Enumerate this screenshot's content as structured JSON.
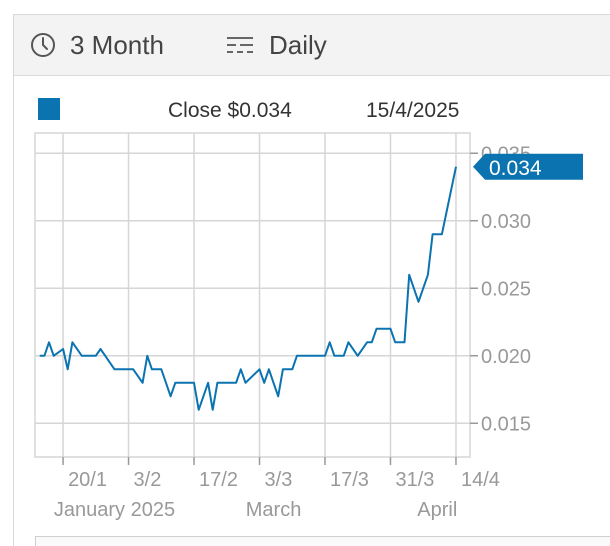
{
  "toolbar": {
    "range_icon": "clock-icon",
    "range_label": "3 Month",
    "interval_icon": "interval-lines-icon",
    "interval_label": "Daily"
  },
  "legend": {
    "swatch_color": "#0a73b0",
    "close_label": "Close $0.034",
    "date_label": "15/4/2025"
  },
  "colors": {
    "line": "#0a73b0",
    "badge": "#0a73b0",
    "grid": "#d6d6d6",
    "tick": "#999999"
  },
  "chart_data": {
    "type": "line",
    "y_ticks": [
      "0.015",
      "0.020",
      "0.025",
      "0.030",
      "0.035"
    ],
    "y_tick_values": [
      0.015,
      0.02,
      0.025,
      0.03,
      0.035
    ],
    "ylim": [
      0.0125,
      0.0365
    ],
    "x_ticks": [
      "20/1",
      "3/2",
      "17/2",
      "3/3",
      "17/3",
      "31/3",
      "14/4"
    ],
    "x_tick_dates": [
      "2025-01-20",
      "2025-02-03",
      "2025-02-17",
      "2025-03-03",
      "2025-03-17",
      "2025-03-31",
      "2025-04-14"
    ],
    "x_month_labels": [
      {
        "label": "January 2025",
        "date": "2025-01-31"
      },
      {
        "label": "March",
        "date": "2025-03-06"
      },
      {
        "label": "April",
        "date": "2025-04-10"
      }
    ],
    "xlim": [
      "2025-01-14",
      "2025-04-17"
    ],
    "grid": true,
    "last_value_label": "0.034",
    "series": [
      {
        "color": "#0a73b0",
        "points": [
          [
            "2025-01-15",
            0.02
          ],
          [
            "2025-01-16",
            0.02
          ],
          [
            "2025-01-17",
            0.021
          ],
          [
            "2025-01-18",
            0.02
          ],
          [
            "2025-01-20",
            0.0205
          ],
          [
            "2025-01-21",
            0.019
          ],
          [
            "2025-01-22",
            0.021
          ],
          [
            "2025-01-24",
            0.02
          ],
          [
            "2025-01-27",
            0.02
          ],
          [
            "2025-01-28",
            0.0205
          ],
          [
            "2025-01-29",
            0.02
          ],
          [
            "2025-01-31",
            0.019
          ],
          [
            "2025-02-03",
            0.019
          ],
          [
            "2025-02-04",
            0.019
          ],
          [
            "2025-02-06",
            0.018
          ],
          [
            "2025-02-07",
            0.02
          ],
          [
            "2025-02-08",
            0.019
          ],
          [
            "2025-02-10",
            0.019
          ],
          [
            "2025-02-11",
            0.018
          ],
          [
            "2025-02-12",
            0.017
          ],
          [
            "2025-02-13",
            0.018
          ],
          [
            "2025-02-17",
            0.018
          ],
          [
            "2025-02-18",
            0.016
          ],
          [
            "2025-02-19",
            0.017
          ],
          [
            "2025-02-20",
            0.018
          ],
          [
            "2025-02-21",
            0.016
          ],
          [
            "2025-02-22",
            0.018
          ],
          [
            "2025-02-26",
            0.018
          ],
          [
            "2025-02-27",
            0.019
          ],
          [
            "2025-02-28",
            0.018
          ],
          [
            "2025-03-03",
            0.019
          ],
          [
            "2025-03-04",
            0.018
          ],
          [
            "2025-03-05",
            0.019
          ],
          [
            "2025-03-06",
            0.018
          ],
          [
            "2025-03-07",
            0.017
          ],
          [
            "2025-03-08",
            0.019
          ],
          [
            "2025-03-10",
            0.019
          ],
          [
            "2025-03-11",
            0.02
          ],
          [
            "2025-03-17",
            0.02
          ],
          [
            "2025-03-18",
            0.021
          ],
          [
            "2025-03-19",
            0.02
          ],
          [
            "2025-03-21",
            0.02
          ],
          [
            "2025-03-22",
            0.021
          ],
          [
            "2025-03-24",
            0.02
          ],
          [
            "2025-03-26",
            0.021
          ],
          [
            "2025-03-27",
            0.021
          ],
          [
            "2025-03-28",
            0.022
          ],
          [
            "2025-03-31",
            0.022
          ],
          [
            "2025-04-01",
            0.021
          ],
          [
            "2025-04-03",
            0.021
          ],
          [
            "2025-04-04",
            0.026
          ],
          [
            "2025-04-06",
            0.024
          ],
          [
            "2025-04-08",
            0.026
          ],
          [
            "2025-04-09",
            0.029
          ],
          [
            "2025-04-11",
            0.029
          ],
          [
            "2025-04-14",
            0.034
          ]
        ]
      }
    ]
  }
}
